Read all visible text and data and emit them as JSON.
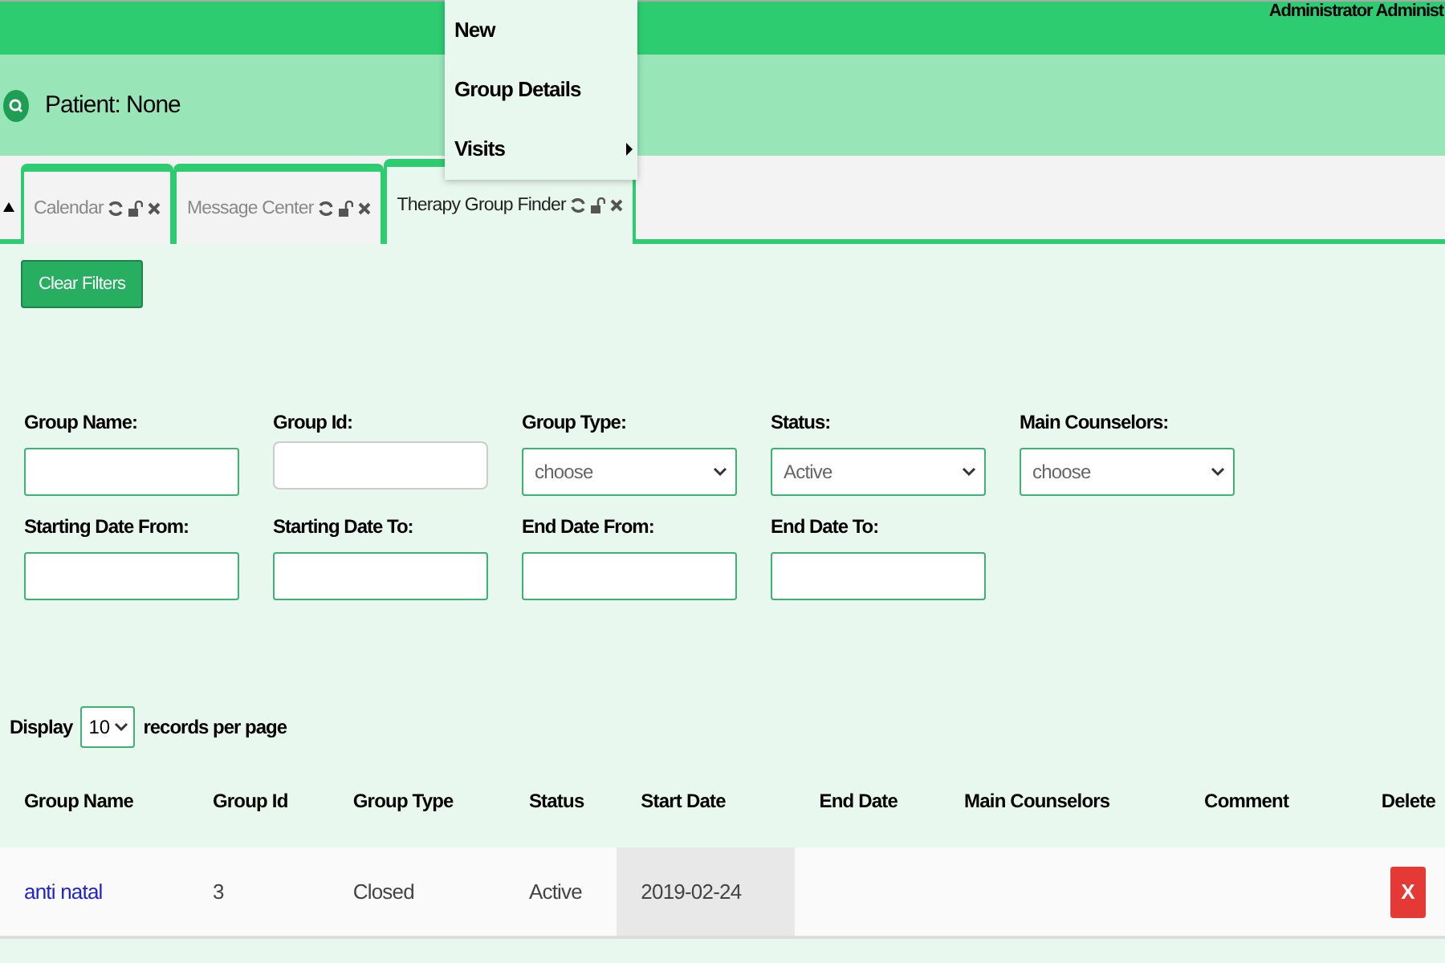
{
  "header": {
    "user": "Administrator Administ"
  },
  "menu": {
    "items": [
      {
        "label": "New",
        "has_submenu": false
      },
      {
        "label": "Group Details",
        "has_submenu": false
      },
      {
        "label": "Visits",
        "has_submenu": true
      }
    ]
  },
  "patient_bar": {
    "label": "Patient: None"
  },
  "tabs": [
    {
      "label": "Calendar",
      "selected": false
    },
    {
      "label": "Message Center",
      "selected": false
    },
    {
      "label": "Therapy Group Finder",
      "selected": true
    }
  ],
  "clear_filters": "Clear Filters",
  "filters": [
    {
      "label": "Group Name:",
      "kind": "text"
    },
    {
      "label": "Group Id:",
      "kind": "number"
    },
    {
      "label": "Group Type:",
      "kind": "select",
      "value": "choose"
    },
    {
      "label": "Status:",
      "kind": "select",
      "value": "Active"
    },
    {
      "label": "Main Counselors:",
      "kind": "select",
      "value": "choose"
    },
    {
      "label": "Starting Date From:",
      "kind": "text"
    },
    {
      "label": "Starting Date To:",
      "kind": "text"
    },
    {
      "label": "End Date From:",
      "kind": "text"
    },
    {
      "label": "End Date To:",
      "kind": "text"
    }
  ],
  "paging": {
    "prefix": "Display",
    "page_size": "10",
    "suffix": "records per page"
  },
  "table": {
    "columns": [
      {
        "label": "Group Name",
        "sorted": false
      },
      {
        "label": "Group Id",
        "sorted": false
      },
      {
        "label": "Group Type",
        "sorted": false
      },
      {
        "label": "Status",
        "sorted": false
      },
      {
        "label": "Start Date",
        "sorted": true
      },
      {
        "label": "End Date",
        "sorted": false
      },
      {
        "label": "Main Counselors",
        "sorted": false
      },
      {
        "label": "Comment",
        "sorted": false
      },
      {
        "label": "Delete",
        "sorted": false
      }
    ],
    "rows": [
      {
        "group_name": "anti natal",
        "group_id": "3",
        "group_type": "Closed",
        "status": "Active",
        "start_date": "2019-02-24",
        "delete": "X"
      }
    ]
  }
}
